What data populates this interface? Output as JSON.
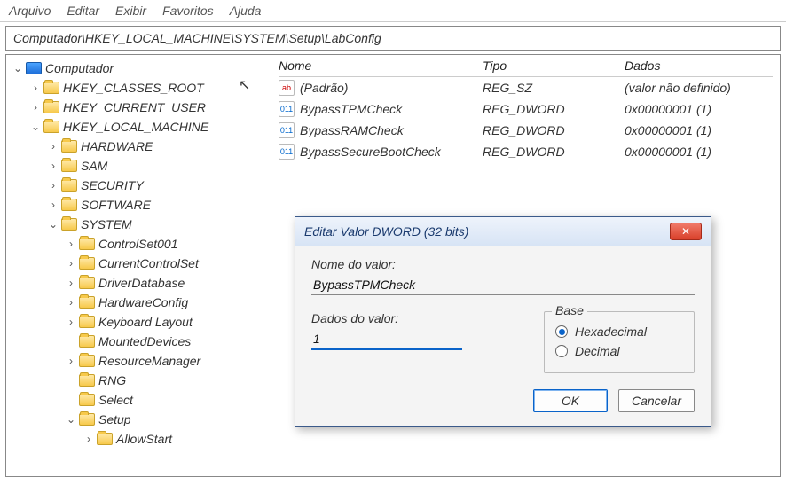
{
  "menu": {
    "items": [
      "Arquivo",
      "Editar",
      "Exibir",
      "Favoritos",
      "Ajuda"
    ]
  },
  "address": "Computador\\HKEY_LOCAL_MACHINE\\SYSTEM\\Setup\\LabConfig",
  "tree": {
    "root": "Computador",
    "hkcr": "HKEY_CLASSES_ROOT",
    "hkcu": "HKEY_CURRENT_USER",
    "hklm": "HKEY_LOCAL_MACHINE",
    "hklm_children": [
      "HARDWARE",
      "SAM",
      "SECURITY",
      "SOFTWARE"
    ],
    "system": "SYSTEM",
    "system_children": [
      "ControlSet001",
      "CurrentControlSet",
      "DriverDatabase",
      "HardwareConfig",
      "Keyboard Layout",
      "MountedDevices",
      "ResourceManager",
      "RNG",
      "Select"
    ],
    "setup": "Setup",
    "setup_children": [
      "AllowStart"
    ]
  },
  "list": {
    "columns": {
      "name": "Nome",
      "type": "Tipo",
      "data": "Dados"
    },
    "rows": [
      {
        "kind": "str",
        "name": "(Padrão)",
        "type": "REG_SZ",
        "data": "(valor não definido)"
      },
      {
        "kind": "dw",
        "name": "BypassTPMCheck",
        "type": "REG_DWORD",
        "data": "0x00000001 (1)"
      },
      {
        "kind": "dw",
        "name": "BypassRAMCheck",
        "type": "REG_DWORD",
        "data": "0x00000001 (1)"
      },
      {
        "kind": "dw",
        "name": "BypassSecureBootCheck",
        "type": "REG_DWORD",
        "data": "0x00000001 (1)"
      }
    ]
  },
  "dialog": {
    "title": "Editar Valor DWORD (32 bits)",
    "name_label": "Nome do valor:",
    "name_value": "BypassTPMCheck",
    "data_label": "Dados do valor:",
    "data_value": "1",
    "base_label": "Base",
    "radio_hex": "Hexadecimal",
    "radio_dec": "Decimal",
    "ok": "OK",
    "cancel": "Cancelar"
  },
  "icon_text": {
    "str": "ab",
    "dw": "011"
  }
}
